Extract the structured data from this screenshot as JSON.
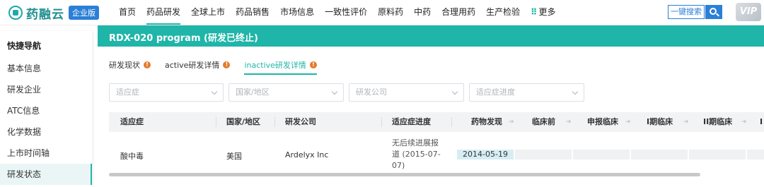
{
  "brand": {
    "name": "药融云",
    "badge": "企业版"
  },
  "nav": [
    "首页",
    "药品研发",
    "全球上市",
    "药品销售",
    "市场信息",
    "一致性评价",
    "原料药",
    "中药",
    "合理用药",
    "生产检验",
    "更多"
  ],
  "search": {
    "label": "一键搜索"
  },
  "vip": "VIP",
  "sidebar": {
    "title": "快捷导航",
    "items": [
      "基本信息",
      "研发企业",
      "ATC信息",
      "化学数据",
      "上市时间轴",
      "研发状态"
    ]
  },
  "header": {
    "title": "RDX-020 program (研发已终止)"
  },
  "tabs": [
    "研发现状",
    "active研发详情",
    "inactive研发详情"
  ],
  "filters": {
    "indication": "适应症",
    "country": "国家/地区",
    "company": "研发公司",
    "progress": "适应症进度"
  },
  "table": {
    "headers": [
      "适应症",
      "国家/地区",
      "研发公司",
      "适应症进度",
      "药物发现",
      "临床前",
      "申报临床",
      "I期临床",
      "II期临床",
      "I"
    ],
    "row": {
      "indication": "酸中毒",
      "country": "美国",
      "company": "Ardelyx Inc",
      "progress": "无后续进展报道 (2015-07-07)",
      "discovery_date": "2014-05-19"
    }
  },
  "colors": {
    "accent": "#1fb5a8",
    "brand_blue": "#2b7fd6",
    "info": "#e37b2b"
  }
}
